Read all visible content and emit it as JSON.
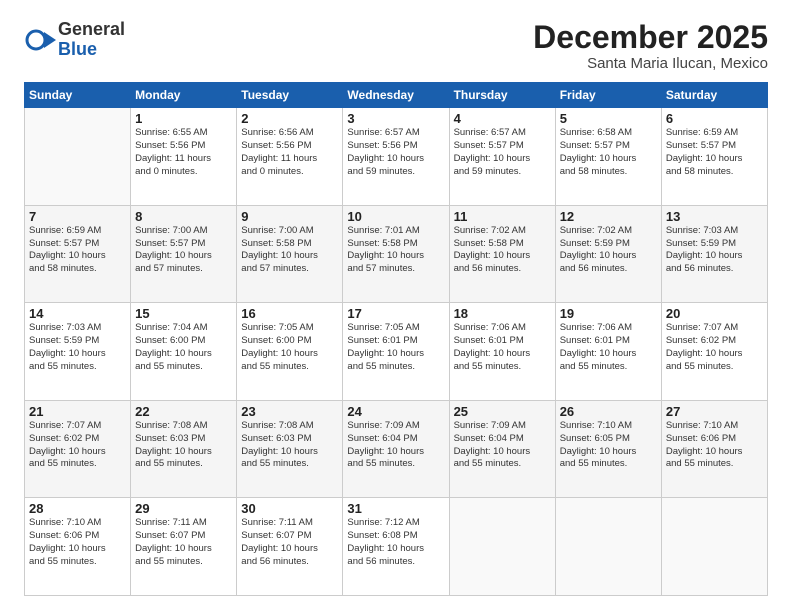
{
  "header": {
    "logo_general": "General",
    "logo_blue": "Blue",
    "month_title": "December 2025",
    "location": "Santa Maria Ilucan, Mexico"
  },
  "days_of_week": [
    "Sunday",
    "Monday",
    "Tuesday",
    "Wednesday",
    "Thursday",
    "Friday",
    "Saturday"
  ],
  "weeks": [
    [
      {
        "day": "",
        "info": ""
      },
      {
        "day": "1",
        "info": "Sunrise: 6:55 AM\nSunset: 5:56 PM\nDaylight: 11 hours\nand 0 minutes."
      },
      {
        "day": "2",
        "info": "Sunrise: 6:56 AM\nSunset: 5:56 PM\nDaylight: 11 hours\nand 0 minutes."
      },
      {
        "day": "3",
        "info": "Sunrise: 6:57 AM\nSunset: 5:56 PM\nDaylight: 10 hours\nand 59 minutes."
      },
      {
        "day": "4",
        "info": "Sunrise: 6:57 AM\nSunset: 5:57 PM\nDaylight: 10 hours\nand 59 minutes."
      },
      {
        "day": "5",
        "info": "Sunrise: 6:58 AM\nSunset: 5:57 PM\nDaylight: 10 hours\nand 58 minutes."
      },
      {
        "day": "6",
        "info": "Sunrise: 6:59 AM\nSunset: 5:57 PM\nDaylight: 10 hours\nand 58 minutes."
      }
    ],
    [
      {
        "day": "7",
        "info": "Sunrise: 6:59 AM\nSunset: 5:57 PM\nDaylight: 10 hours\nand 58 minutes."
      },
      {
        "day": "8",
        "info": "Sunrise: 7:00 AM\nSunset: 5:57 PM\nDaylight: 10 hours\nand 57 minutes."
      },
      {
        "day": "9",
        "info": "Sunrise: 7:00 AM\nSunset: 5:58 PM\nDaylight: 10 hours\nand 57 minutes."
      },
      {
        "day": "10",
        "info": "Sunrise: 7:01 AM\nSunset: 5:58 PM\nDaylight: 10 hours\nand 57 minutes."
      },
      {
        "day": "11",
        "info": "Sunrise: 7:02 AM\nSunset: 5:58 PM\nDaylight: 10 hours\nand 56 minutes."
      },
      {
        "day": "12",
        "info": "Sunrise: 7:02 AM\nSunset: 5:59 PM\nDaylight: 10 hours\nand 56 minutes."
      },
      {
        "day": "13",
        "info": "Sunrise: 7:03 AM\nSunset: 5:59 PM\nDaylight: 10 hours\nand 56 minutes."
      }
    ],
    [
      {
        "day": "14",
        "info": "Sunrise: 7:03 AM\nSunset: 5:59 PM\nDaylight: 10 hours\nand 55 minutes."
      },
      {
        "day": "15",
        "info": "Sunrise: 7:04 AM\nSunset: 6:00 PM\nDaylight: 10 hours\nand 55 minutes."
      },
      {
        "day": "16",
        "info": "Sunrise: 7:05 AM\nSunset: 6:00 PM\nDaylight: 10 hours\nand 55 minutes."
      },
      {
        "day": "17",
        "info": "Sunrise: 7:05 AM\nSunset: 6:01 PM\nDaylight: 10 hours\nand 55 minutes."
      },
      {
        "day": "18",
        "info": "Sunrise: 7:06 AM\nSunset: 6:01 PM\nDaylight: 10 hours\nand 55 minutes."
      },
      {
        "day": "19",
        "info": "Sunrise: 7:06 AM\nSunset: 6:01 PM\nDaylight: 10 hours\nand 55 minutes."
      },
      {
        "day": "20",
        "info": "Sunrise: 7:07 AM\nSunset: 6:02 PM\nDaylight: 10 hours\nand 55 minutes."
      }
    ],
    [
      {
        "day": "21",
        "info": "Sunrise: 7:07 AM\nSunset: 6:02 PM\nDaylight: 10 hours\nand 55 minutes."
      },
      {
        "day": "22",
        "info": "Sunrise: 7:08 AM\nSunset: 6:03 PM\nDaylight: 10 hours\nand 55 minutes."
      },
      {
        "day": "23",
        "info": "Sunrise: 7:08 AM\nSunset: 6:03 PM\nDaylight: 10 hours\nand 55 minutes."
      },
      {
        "day": "24",
        "info": "Sunrise: 7:09 AM\nSunset: 6:04 PM\nDaylight: 10 hours\nand 55 minutes."
      },
      {
        "day": "25",
        "info": "Sunrise: 7:09 AM\nSunset: 6:04 PM\nDaylight: 10 hours\nand 55 minutes."
      },
      {
        "day": "26",
        "info": "Sunrise: 7:10 AM\nSunset: 6:05 PM\nDaylight: 10 hours\nand 55 minutes."
      },
      {
        "day": "27",
        "info": "Sunrise: 7:10 AM\nSunset: 6:06 PM\nDaylight: 10 hours\nand 55 minutes."
      }
    ],
    [
      {
        "day": "28",
        "info": "Sunrise: 7:10 AM\nSunset: 6:06 PM\nDaylight: 10 hours\nand 55 minutes."
      },
      {
        "day": "29",
        "info": "Sunrise: 7:11 AM\nSunset: 6:07 PM\nDaylight: 10 hours\nand 55 minutes."
      },
      {
        "day": "30",
        "info": "Sunrise: 7:11 AM\nSunset: 6:07 PM\nDaylight: 10 hours\nand 56 minutes."
      },
      {
        "day": "31",
        "info": "Sunrise: 7:12 AM\nSunset: 6:08 PM\nDaylight: 10 hours\nand 56 minutes."
      },
      {
        "day": "",
        "info": ""
      },
      {
        "day": "",
        "info": ""
      },
      {
        "day": "",
        "info": ""
      }
    ]
  ]
}
